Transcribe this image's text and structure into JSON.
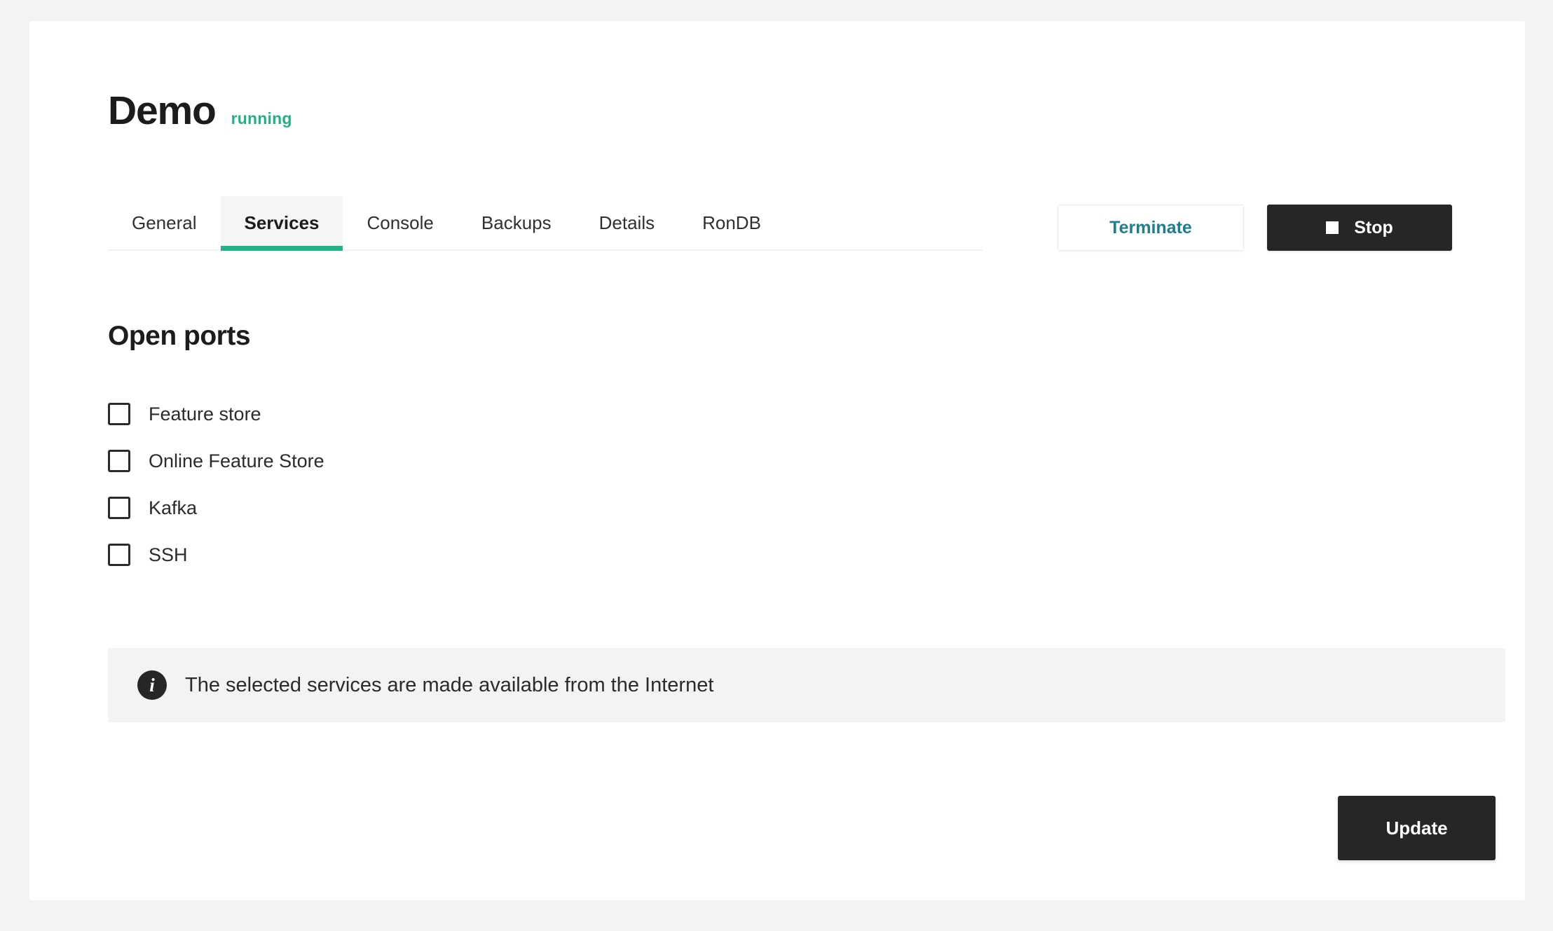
{
  "header": {
    "title": "Demo",
    "status": "running"
  },
  "tabs": [
    {
      "label": "General",
      "active": false
    },
    {
      "label": "Services",
      "active": true
    },
    {
      "label": "Console",
      "active": false
    },
    {
      "label": "Backups",
      "active": false
    },
    {
      "label": "Details",
      "active": false
    },
    {
      "label": "RonDB",
      "active": false
    }
  ],
  "actions": {
    "terminate_label": "Terminate",
    "stop_label": "Stop",
    "stop_icon": "stop-square-icon"
  },
  "section": {
    "title": "Open ports"
  },
  "ports": [
    {
      "label": "Feature store",
      "checked": false
    },
    {
      "label": "Online Feature Store",
      "checked": false
    },
    {
      "label": "Kafka",
      "checked": false
    },
    {
      "label": "SSH",
      "checked": false
    }
  ],
  "info": {
    "icon": "info-circle-icon",
    "message": "The selected services are made available from the Internet"
  },
  "footer": {
    "update_label": "Update"
  },
  "colors": {
    "accent_green": "#21b187",
    "terminate_text": "#1d7e8e",
    "dark_button": "#262626",
    "page_background": "#f2f3f3",
    "card_background": "#ffffff",
    "banner_background": "#f3f3f3"
  }
}
